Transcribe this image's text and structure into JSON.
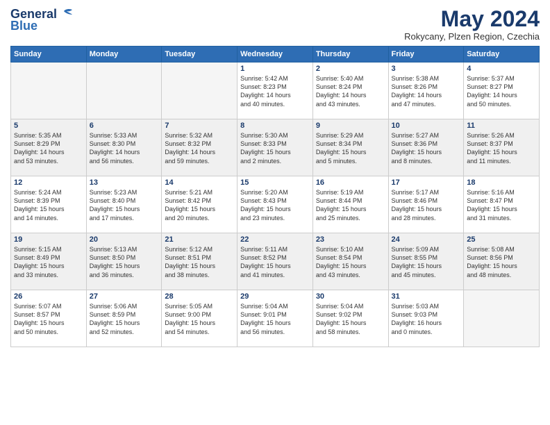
{
  "header": {
    "logo_line1": "General",
    "logo_line2": "Blue",
    "month_title": "May 2024",
    "location": "Rokycany, Plzen Region, Czechia"
  },
  "days_of_week": [
    "Sunday",
    "Monday",
    "Tuesday",
    "Wednesday",
    "Thursday",
    "Friday",
    "Saturday"
  ],
  "weeks": [
    {
      "shaded": false,
      "days": [
        {
          "num": "",
          "info": ""
        },
        {
          "num": "",
          "info": ""
        },
        {
          "num": "",
          "info": ""
        },
        {
          "num": "1",
          "info": "Sunrise: 5:42 AM\nSunset: 8:23 PM\nDaylight: 14 hours\nand 40 minutes."
        },
        {
          "num": "2",
          "info": "Sunrise: 5:40 AM\nSunset: 8:24 PM\nDaylight: 14 hours\nand 43 minutes."
        },
        {
          "num": "3",
          "info": "Sunrise: 5:38 AM\nSunset: 8:26 PM\nDaylight: 14 hours\nand 47 minutes."
        },
        {
          "num": "4",
          "info": "Sunrise: 5:37 AM\nSunset: 8:27 PM\nDaylight: 14 hours\nand 50 minutes."
        }
      ]
    },
    {
      "shaded": true,
      "days": [
        {
          "num": "5",
          "info": "Sunrise: 5:35 AM\nSunset: 8:29 PM\nDaylight: 14 hours\nand 53 minutes."
        },
        {
          "num": "6",
          "info": "Sunrise: 5:33 AM\nSunset: 8:30 PM\nDaylight: 14 hours\nand 56 minutes."
        },
        {
          "num": "7",
          "info": "Sunrise: 5:32 AM\nSunset: 8:32 PM\nDaylight: 14 hours\nand 59 minutes."
        },
        {
          "num": "8",
          "info": "Sunrise: 5:30 AM\nSunset: 8:33 PM\nDaylight: 15 hours\nand 2 minutes."
        },
        {
          "num": "9",
          "info": "Sunrise: 5:29 AM\nSunset: 8:34 PM\nDaylight: 15 hours\nand 5 minutes."
        },
        {
          "num": "10",
          "info": "Sunrise: 5:27 AM\nSunset: 8:36 PM\nDaylight: 15 hours\nand 8 minutes."
        },
        {
          "num": "11",
          "info": "Sunrise: 5:26 AM\nSunset: 8:37 PM\nDaylight: 15 hours\nand 11 minutes."
        }
      ]
    },
    {
      "shaded": false,
      "days": [
        {
          "num": "12",
          "info": "Sunrise: 5:24 AM\nSunset: 8:39 PM\nDaylight: 15 hours\nand 14 minutes."
        },
        {
          "num": "13",
          "info": "Sunrise: 5:23 AM\nSunset: 8:40 PM\nDaylight: 15 hours\nand 17 minutes."
        },
        {
          "num": "14",
          "info": "Sunrise: 5:21 AM\nSunset: 8:42 PM\nDaylight: 15 hours\nand 20 minutes."
        },
        {
          "num": "15",
          "info": "Sunrise: 5:20 AM\nSunset: 8:43 PM\nDaylight: 15 hours\nand 23 minutes."
        },
        {
          "num": "16",
          "info": "Sunrise: 5:19 AM\nSunset: 8:44 PM\nDaylight: 15 hours\nand 25 minutes."
        },
        {
          "num": "17",
          "info": "Sunrise: 5:17 AM\nSunset: 8:46 PM\nDaylight: 15 hours\nand 28 minutes."
        },
        {
          "num": "18",
          "info": "Sunrise: 5:16 AM\nSunset: 8:47 PM\nDaylight: 15 hours\nand 31 minutes."
        }
      ]
    },
    {
      "shaded": true,
      "days": [
        {
          "num": "19",
          "info": "Sunrise: 5:15 AM\nSunset: 8:49 PM\nDaylight: 15 hours\nand 33 minutes."
        },
        {
          "num": "20",
          "info": "Sunrise: 5:13 AM\nSunset: 8:50 PM\nDaylight: 15 hours\nand 36 minutes."
        },
        {
          "num": "21",
          "info": "Sunrise: 5:12 AM\nSunset: 8:51 PM\nDaylight: 15 hours\nand 38 minutes."
        },
        {
          "num": "22",
          "info": "Sunrise: 5:11 AM\nSunset: 8:52 PM\nDaylight: 15 hours\nand 41 minutes."
        },
        {
          "num": "23",
          "info": "Sunrise: 5:10 AM\nSunset: 8:54 PM\nDaylight: 15 hours\nand 43 minutes."
        },
        {
          "num": "24",
          "info": "Sunrise: 5:09 AM\nSunset: 8:55 PM\nDaylight: 15 hours\nand 45 minutes."
        },
        {
          "num": "25",
          "info": "Sunrise: 5:08 AM\nSunset: 8:56 PM\nDaylight: 15 hours\nand 48 minutes."
        }
      ]
    },
    {
      "shaded": false,
      "days": [
        {
          "num": "26",
          "info": "Sunrise: 5:07 AM\nSunset: 8:57 PM\nDaylight: 15 hours\nand 50 minutes."
        },
        {
          "num": "27",
          "info": "Sunrise: 5:06 AM\nSunset: 8:59 PM\nDaylight: 15 hours\nand 52 minutes."
        },
        {
          "num": "28",
          "info": "Sunrise: 5:05 AM\nSunset: 9:00 PM\nDaylight: 15 hours\nand 54 minutes."
        },
        {
          "num": "29",
          "info": "Sunrise: 5:04 AM\nSunset: 9:01 PM\nDaylight: 15 hours\nand 56 minutes."
        },
        {
          "num": "30",
          "info": "Sunrise: 5:04 AM\nSunset: 9:02 PM\nDaylight: 15 hours\nand 58 minutes."
        },
        {
          "num": "31",
          "info": "Sunrise: 5:03 AM\nSunset: 9:03 PM\nDaylight: 16 hours\nand 0 minutes."
        },
        {
          "num": "",
          "info": ""
        }
      ]
    }
  ]
}
